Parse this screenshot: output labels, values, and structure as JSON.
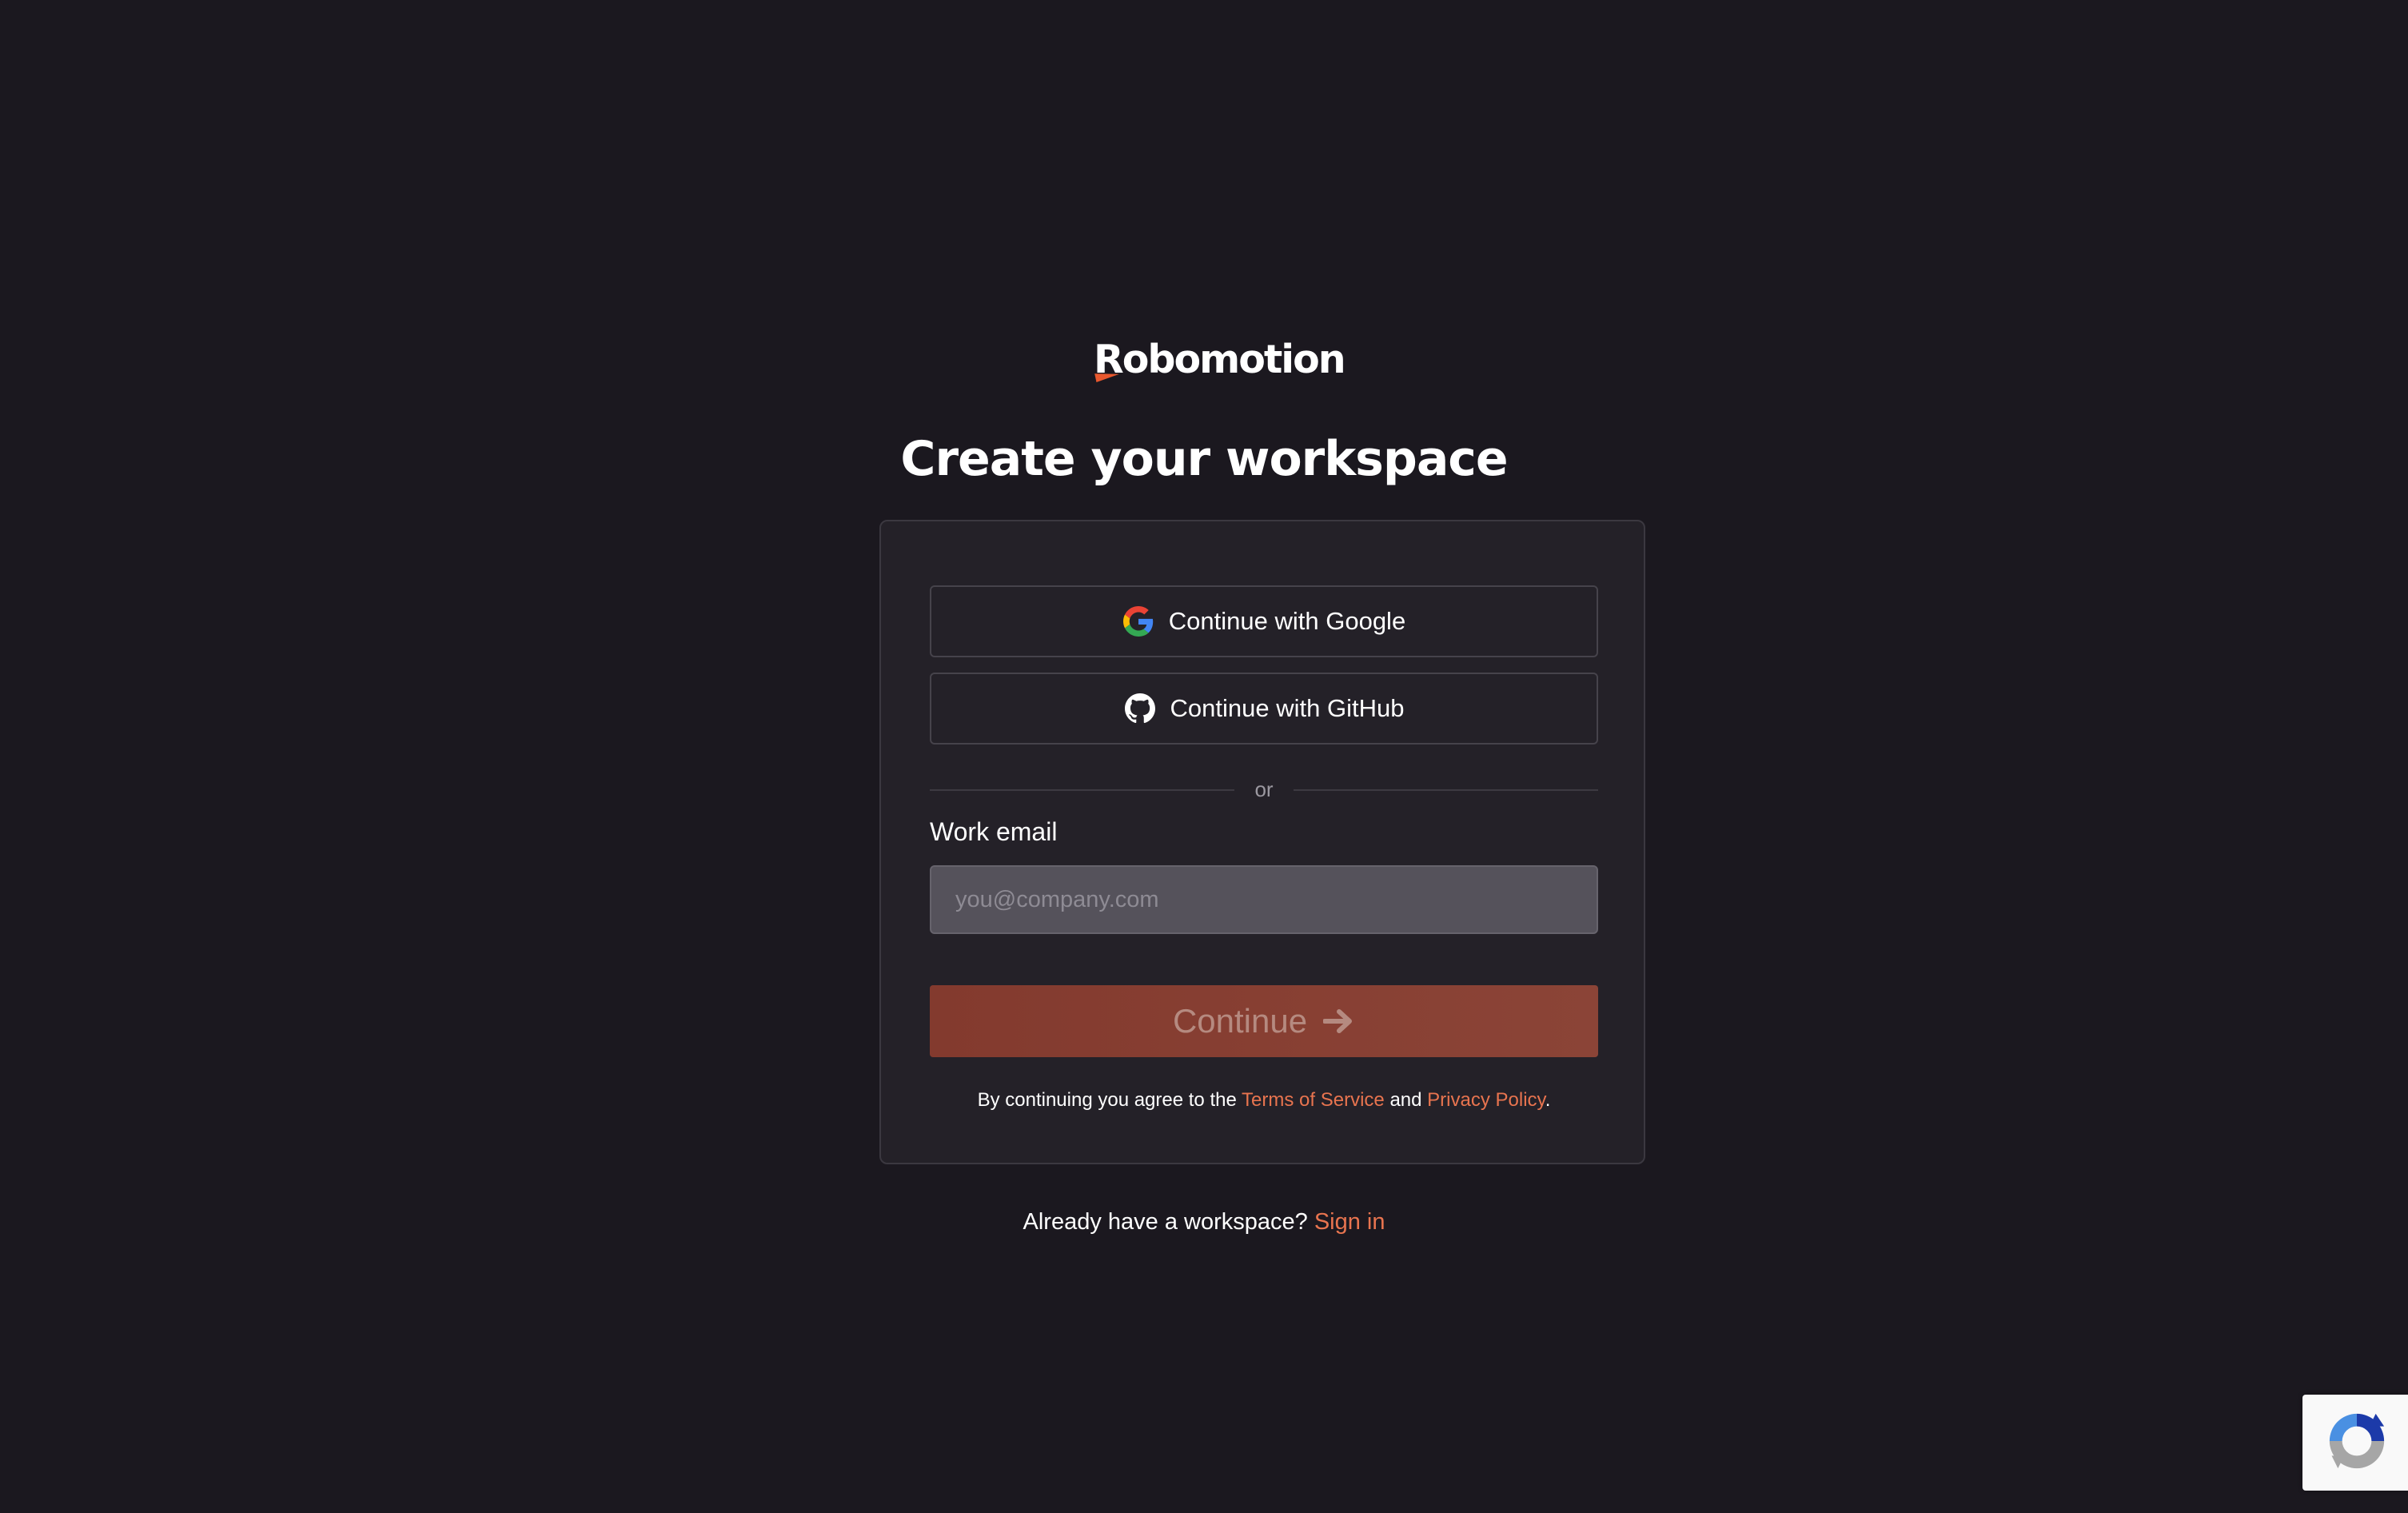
{
  "brand": {
    "name": "Robomotion",
    "accent_color": "#e8582e"
  },
  "page": {
    "title": "Create your workspace"
  },
  "oauth": {
    "google_label": "Continue with Google",
    "github_label": "Continue with GitHub"
  },
  "divider": {
    "text": "or"
  },
  "email": {
    "label": "Work email",
    "placeholder": "you@company.com",
    "value": ""
  },
  "continue_button": {
    "label": "Continue",
    "icon": "arrow-right-icon"
  },
  "legal": {
    "prefix": "By continuing you agree to the",
    "terms_link": "Terms of Service",
    "and": "and",
    "privacy_link": "Privacy Policy",
    "suffix": "."
  },
  "signin": {
    "prompt": "Already have a workspace?",
    "link": "Sign in"
  },
  "colors": {
    "background": "#1b181f",
    "card": "#242128",
    "link": "#e8744f",
    "continue_button": "#853c30"
  },
  "icons": {
    "google": "google-icon",
    "github": "github-icon",
    "recaptcha": "recaptcha-icon"
  }
}
